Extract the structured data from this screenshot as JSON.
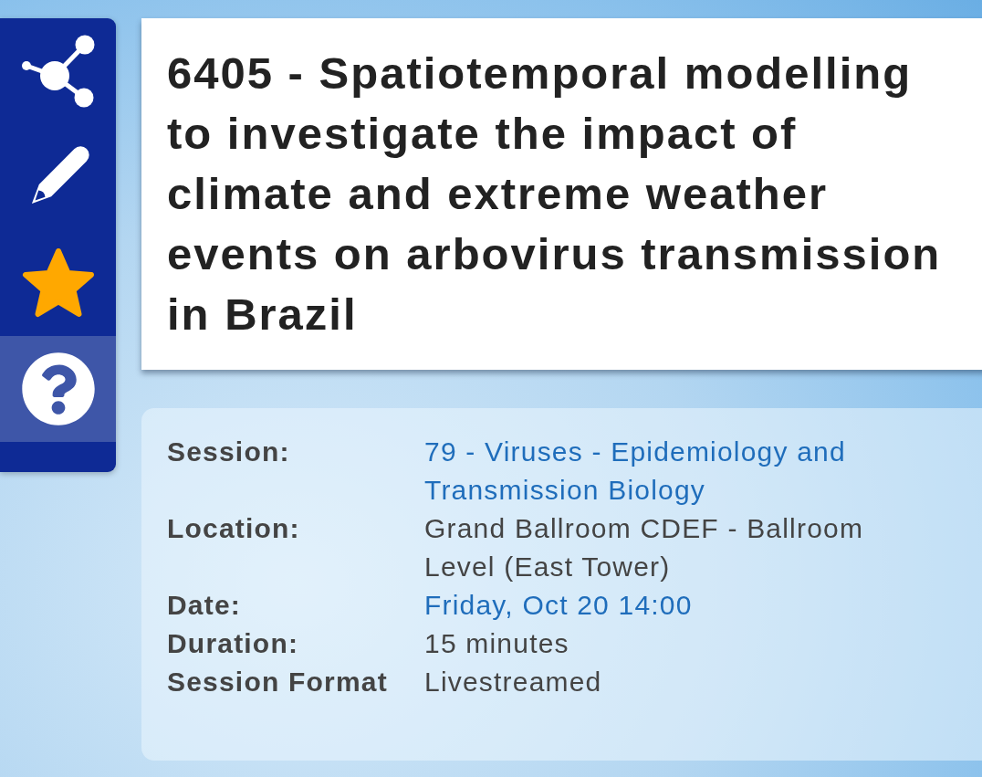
{
  "sidebar": {
    "items": [
      {
        "kind": "share",
        "selected": false
      },
      {
        "kind": "edit",
        "selected": false
      },
      {
        "kind": "favorite",
        "selected": false
      },
      {
        "kind": "help",
        "selected": true
      }
    ]
  },
  "title": "6405 - Spatiotemporal modelling to investigate the impact of climate and extreme weather events on arbovirus transmission in Brazil",
  "details": [
    {
      "label": "Session:",
      "value": "79 - Viruses - Epidemiology and Transmission Biology",
      "kind": "link"
    },
    {
      "label": "Location:",
      "value": "Grand Ballroom CDEF - Ballroom Level (East Tower)",
      "kind": "text"
    },
    {
      "label": "Date:",
      "value": "Friday, Oct 20 14:00",
      "kind": "link"
    },
    {
      "label": "Duration:",
      "value": "15 minutes",
      "kind": "text"
    },
    {
      "label": "Session Format",
      "value": "Livestreamed",
      "kind": "text"
    }
  ]
}
